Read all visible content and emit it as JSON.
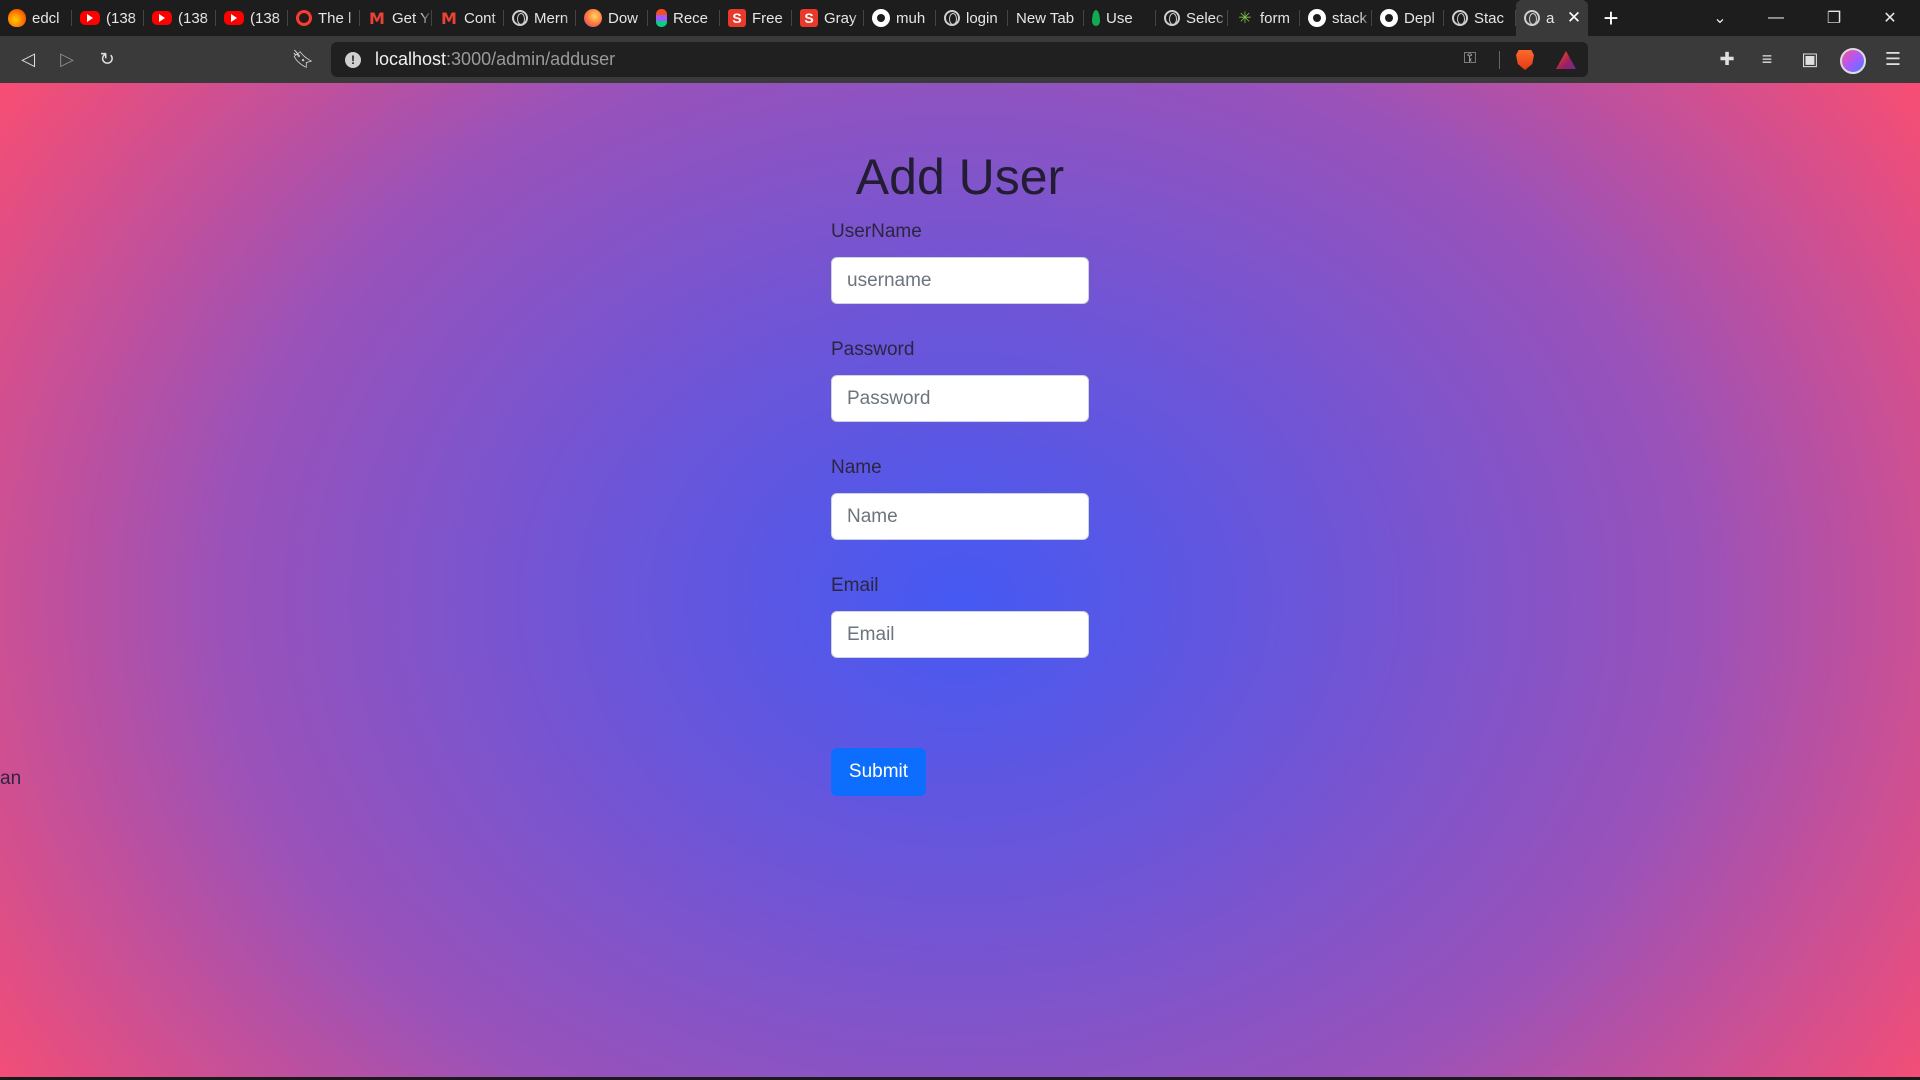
{
  "browser": {
    "tabs": [
      {
        "label": "edcl",
        "icon": "fire-icon",
        "iconClass": "fire"
      },
      {
        "label": "(138",
        "icon": "youtube-icon",
        "iconClass": "yt"
      },
      {
        "label": "(138",
        "icon": "youtube-icon",
        "iconClass": "yt"
      },
      {
        "label": "(138",
        "icon": "youtube-icon",
        "iconClass": "yt"
      },
      {
        "label": "The l",
        "icon": "ring-icon",
        "iconClass": "ring"
      },
      {
        "label": "Get Y",
        "icon": "gmail-icon",
        "iconClass": "gmail"
      },
      {
        "label": "Cont",
        "icon": "gmail-icon",
        "iconClass": "gmail"
      },
      {
        "label": "Mern",
        "icon": "globe-icon",
        "iconClass": "globe"
      },
      {
        "label": "Dow",
        "icon": "firefox-icon",
        "iconClass": "firefox"
      },
      {
        "label": "Rece",
        "icon": "figma-icon",
        "iconClass": "figma"
      },
      {
        "label": "Free",
        "icon": "s-icon",
        "iconClass": "s"
      },
      {
        "label": "Gray",
        "icon": "s-icon",
        "iconClass": "s"
      },
      {
        "label": "muh",
        "icon": "github-icon",
        "iconClass": "gh"
      },
      {
        "label": "login",
        "icon": "globe-icon",
        "iconClass": "globe"
      },
      {
        "label": "New Tab",
        "icon": "",
        "iconClass": "newtab"
      },
      {
        "label": "Use",
        "icon": "mongodb-icon",
        "iconClass": "mongo"
      },
      {
        "label": "Selec",
        "icon": "globe-icon",
        "iconClass": "globe"
      },
      {
        "label": "form",
        "icon": "spark-icon",
        "iconClass": "spark"
      },
      {
        "label": "stack",
        "icon": "github-icon",
        "iconClass": "gh"
      },
      {
        "label": "Depl",
        "icon": "github-icon",
        "iconClass": "gh"
      },
      {
        "label": "Stac",
        "icon": "globe-icon",
        "iconClass": "globe"
      }
    ],
    "active_tab": {
      "label": "a",
      "icon": "globe-icon"
    },
    "url_host": "localhost",
    "url_rest": ":3000/admin/adduser"
  },
  "page": {
    "title": "Add User",
    "fields": [
      {
        "label": "UserName",
        "placeholder": "username",
        "value": ""
      },
      {
        "label": "Password",
        "placeholder": "Password",
        "value": ""
      },
      {
        "label": "Name",
        "placeholder": "Name",
        "value": ""
      },
      {
        "label": "Email",
        "placeholder": "Email",
        "value": ""
      }
    ],
    "submit_label": "Submit",
    "stray_text": "an"
  },
  "colors": {
    "gradient_center": "#4559f3",
    "gradient_edge": "#ff4d6d",
    "submit_bg": "#0d6efd"
  }
}
